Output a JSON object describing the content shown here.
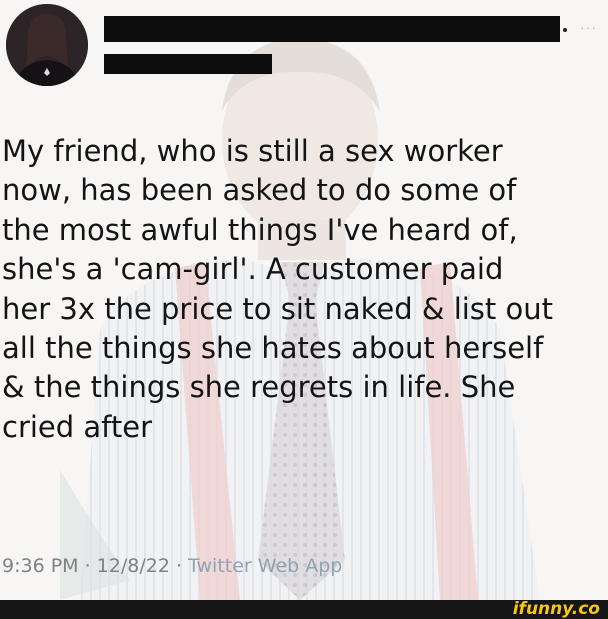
{
  "tweet": {
    "text": "My friend, who is still a sex worker\nnow, has been asked to do some of\nthe most awful things I've heard of,\nshe's a 'cam-girl'. A customer paid\nher 3x the price to sit naked & list out\nall the things she hates about herself\n& the things she regrets in life. She\ncried after",
    "timestamp": "9:36 PM · 12/8/22 · ",
    "source": "Twitter Web App",
    "more_icon": "···"
  },
  "watermark": {
    "brand": "ifunny.co"
  },
  "colors": {
    "text": "#141414",
    "meta": "#7b8388",
    "brand": "#f5c518",
    "bar": "#161616"
  }
}
